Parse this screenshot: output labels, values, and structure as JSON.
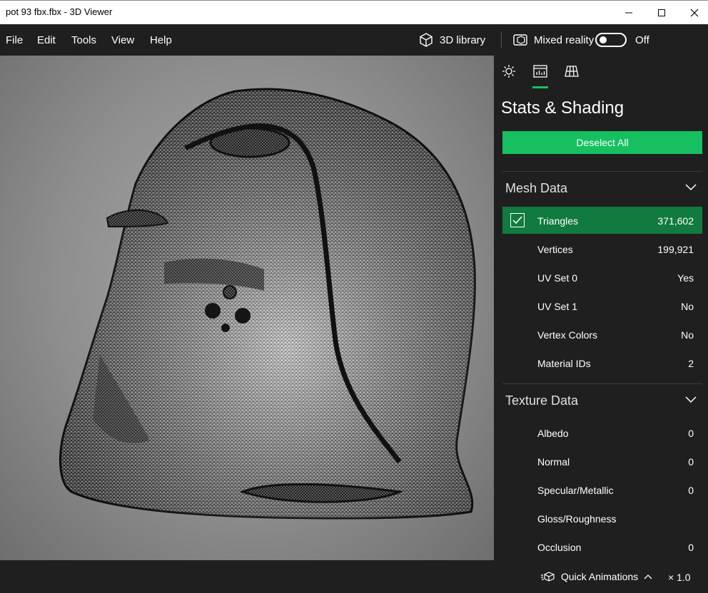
{
  "window": {
    "title": "pot 93 fbx.fbx - 3D Viewer"
  },
  "menu": {
    "items": [
      "File",
      "Edit",
      "Tools",
      "View",
      "Help"
    ]
  },
  "toolbar": {
    "library_label": "3D library",
    "mixed_reality_label": "Mixed reality",
    "toggle_state": "Off"
  },
  "panel": {
    "tabs": [
      "lighting-icon",
      "stats-icon",
      "grid-icon"
    ],
    "title": "Stats & Shading",
    "deselect_label": "Deselect All",
    "mesh_section": {
      "label": "Mesh Data",
      "rows": [
        {
          "name": "Triangles",
          "value": "371,602",
          "checked": true
        },
        {
          "name": "Vertices",
          "value": "199,921"
        },
        {
          "name": "UV Set 0",
          "value": "Yes"
        },
        {
          "name": "UV Set 1",
          "value": "No"
        },
        {
          "name": "Vertex Colors",
          "value": "No"
        },
        {
          "name": "Material IDs",
          "value": "2"
        }
      ]
    },
    "texture_section": {
      "label": "Texture Data",
      "rows": [
        {
          "name": "Albedo",
          "value": "0"
        },
        {
          "name": "Normal",
          "value": "0"
        },
        {
          "name": "Specular/Metallic",
          "value": "0"
        },
        {
          "name": "Gloss/Roughness",
          "value": ""
        },
        {
          "name": "Occlusion",
          "value": "0"
        }
      ]
    }
  },
  "status": {
    "animations_label": "Quick Animations",
    "speed": "× 1.0"
  },
  "colors": {
    "accent": "#16c060",
    "selected_row": "#117a3e",
    "background": "#1f1f1f"
  }
}
